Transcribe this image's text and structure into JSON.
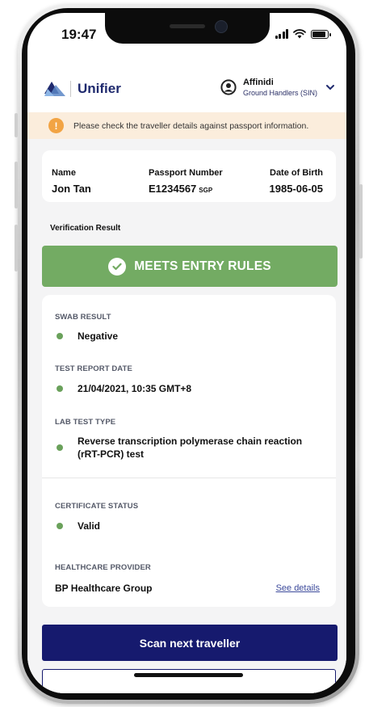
{
  "status_bar": {
    "time": "19:47"
  },
  "header": {
    "logo_text": "Unifier",
    "user_name": "Affinidi",
    "user_org": "Ground Handlers (SIN)"
  },
  "warning": {
    "text": "Please check the traveller details against passport information."
  },
  "traveller": {
    "name_label": "Name",
    "name_value": "Jon Tan",
    "passport_label": "Passport Number",
    "passport_value": "E1234567",
    "passport_country": "SGP",
    "dob_label": "Date of Birth",
    "dob_value": "1985-06-05"
  },
  "verification": {
    "label": "Verification Result",
    "result_text": "MEETS ENTRY RULES"
  },
  "details": {
    "swab_label": "SWAB RESULT",
    "swab_value": "Negative",
    "report_date_label": "TEST REPORT DATE",
    "report_date_value": "21/04/2021, 10:35 GMT+8",
    "lab_type_label": "LAB TEST TYPE",
    "lab_type_value": "Reverse transcription polymerase chain reaction (rRT-PCR) test",
    "cert_status_label": "CERTIFICATE STATUS",
    "cert_status_value": "Valid",
    "provider_label": "HEALTHCARE PROVIDER",
    "provider_value": "BP Healthcare Group",
    "see_details": "See details"
  },
  "actions": {
    "scan_next": "Scan next traveller"
  },
  "colors": {
    "accent": "#161a6e",
    "success": "#73ab63",
    "warning_bg": "#fbeddc",
    "warning_icon": "#f2a444"
  },
  "icons": {
    "logo": "unifier-logo-icon",
    "user": "user-circle-icon",
    "dropdown": "chevron-down-icon",
    "warning": "exclamation-icon",
    "check": "check-icon",
    "status_dot": "dot-icon"
  }
}
